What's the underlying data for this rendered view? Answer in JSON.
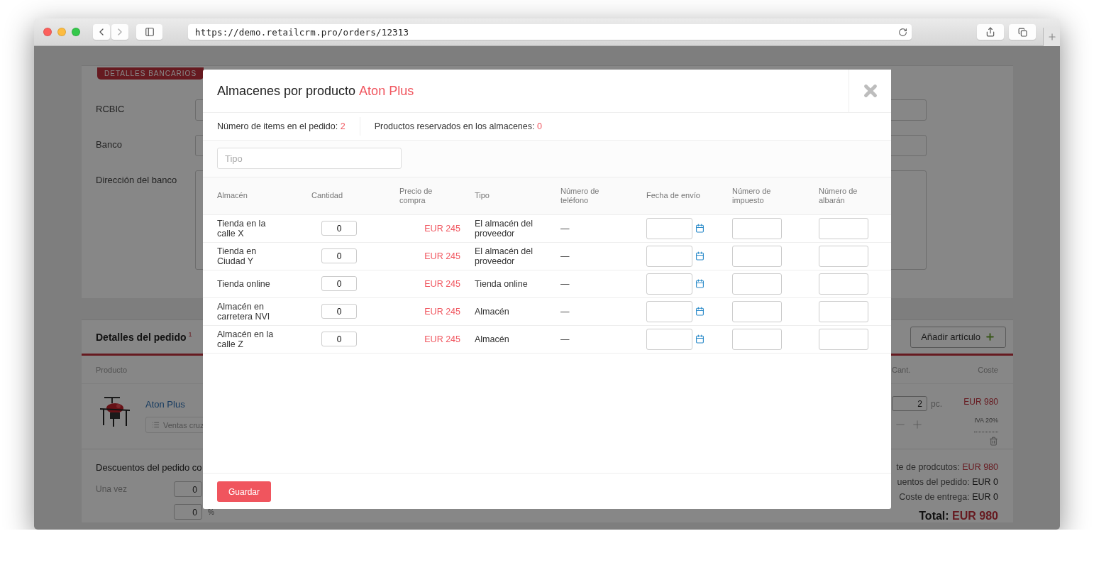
{
  "browser": {
    "url": "https://demo.retailcrm.pro/orders/12313"
  },
  "bank_details": {
    "tag": "DETALLES BANCARIOS",
    "fields": [
      {
        "label": "RCBIC",
        "kind": "input"
      },
      {
        "label": "Banco",
        "kind": "input"
      },
      {
        "label": "Dirección del banco",
        "kind": "textarea"
      }
    ]
  },
  "order_details": {
    "title": "Detalles del pedido",
    "note": "1",
    "add_button": "Añadir artículo",
    "columns": [
      "Producto",
      "Cant.",
      "Coste"
    ],
    "product": {
      "name": "Aton Plus",
      "cross_sell": "Ventas cruz",
      "quantity": "2",
      "unit": "pc.",
      "price": "EUR 980",
      "tax": "IVA 20%"
    },
    "discounts": {
      "title": "Descuentos del pedido co",
      "label": "Una vez",
      "values": [
        "0",
        "0"
      ],
      "percent": "%"
    },
    "totals": [
      {
        "label": "te de prodcutos:",
        "value": "EUR 980",
        "kind": "accent"
      },
      {
        "label": "uentos del pedido:",
        "value": "EUR 0",
        "kind": "plain"
      },
      {
        "label": "Coste de entrega:",
        "value": "EUR 0",
        "kind": "plain"
      }
    ],
    "grand_total": {
      "label": "Total:",
      "value": "EUR 980"
    }
  },
  "modal": {
    "title": "Almacenes por producto",
    "product": "Aton Plus",
    "counts": [
      {
        "label": "Número de items en el pedido:",
        "value": "2"
      },
      {
        "label": "Productos reservados en los almacenes:",
        "value": "0"
      }
    ],
    "filter": {
      "placeholder": "Tipo"
    },
    "columns": [
      "Almacén",
      "Cantidad",
      "Precio de compra",
      "Tipo",
      "Número de teléfono",
      "Fecha de envío",
      "Número de impuesto",
      "Número de albarán"
    ],
    "rows": [
      {
        "warehouse": "Tienda en la calle X",
        "quantity": "0",
        "price": "EUR 245",
        "type": "El almacén del proveedor",
        "phone": "—"
      },
      {
        "warehouse": "Tienda en Ciudad Y",
        "quantity": "0",
        "price": "EUR 245",
        "type": "El almacén del proveedor",
        "phone": "—"
      },
      {
        "warehouse": "Tienda online",
        "quantity": "0",
        "price": "EUR 245",
        "type": "Tienda online",
        "phone": "—"
      },
      {
        "warehouse": "Almacén en carretera NVI",
        "quantity": "0",
        "price": "EUR 245",
        "type": "Almacén",
        "phone": "—"
      },
      {
        "warehouse": "Almacén en la calle Z",
        "quantity": "0",
        "price": "EUR 245",
        "type": "Almacén",
        "phone": "—"
      }
    ],
    "save_button": "Guardar"
  }
}
